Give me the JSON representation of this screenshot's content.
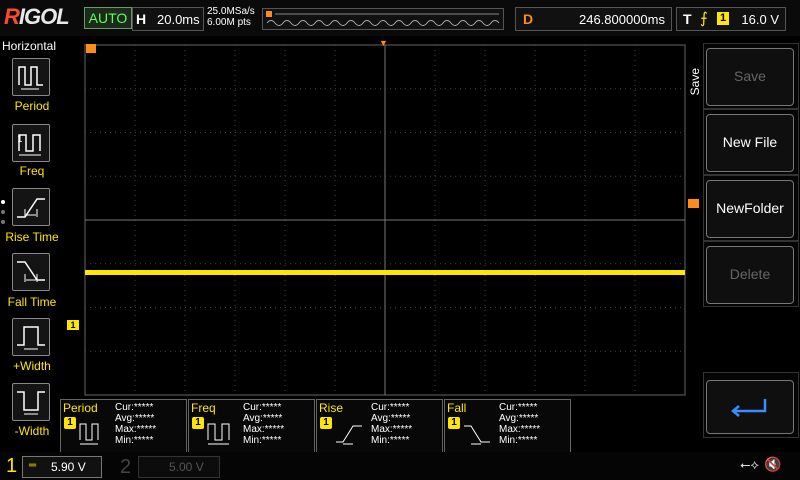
{
  "top": {
    "logo": "RIGOL",
    "run_status": "AUTO",
    "horizontal_label": "H",
    "timebase": "20.0ms",
    "sample_rate": "25.0MSa/s",
    "memory_depth": "6.00M pts",
    "delay_label": "D",
    "delay_value": "246.800000ms",
    "trigger_label": "T",
    "trigger_channel": "1",
    "trigger_level": "16.0 V"
  },
  "left_menu": {
    "header": "Horizontal",
    "items": [
      {
        "label": "Period",
        "icon": "period-icon"
      },
      {
        "label": "Freq",
        "icon": "frequency-icon"
      },
      {
        "label": "Rise Time",
        "icon": "rise-time-icon"
      },
      {
        "label": "Fall Time",
        "icon": "fall-time-icon"
      },
      {
        "label": "+Width",
        "icon": "positive-width-icon"
      },
      {
        "label": "-Width",
        "icon": "negative-width-icon"
      }
    ]
  },
  "waveform": {
    "channel_marker": "1",
    "trigger_marker": "T",
    "trace_color": "#ffe600",
    "trace_level_fraction_from_top": 0.65
  },
  "measurements": [
    {
      "name": "Period",
      "channel": "1",
      "cur": "Cur:*****",
      "avg": "Avg:*****",
      "max": "Max:*****",
      "min": "Min:*****"
    },
    {
      "name": "Freq",
      "channel": "1",
      "cur": "Cur:*****",
      "avg": "Avg:*****",
      "max": "Max:*****",
      "min": "Min:*****"
    },
    {
      "name": "Rise",
      "channel": "1",
      "cur": "Cur:*****",
      "avg": "Avg:*****",
      "max": "Max:*****",
      "min": "Min:*****"
    },
    {
      "name": "Fall",
      "channel": "1",
      "cur": "Cur:*****",
      "avg": "Avg:*****",
      "max": "Max:*****",
      "min": "Min:*****"
    }
  ],
  "right_menu": {
    "title": "Save",
    "buttons": [
      {
        "label": "Save",
        "enabled": false
      },
      {
        "label": "New File",
        "enabled": true
      },
      {
        "label": "NewFolder",
        "enabled": true
      },
      {
        "label": "Delete",
        "enabled": false
      }
    ],
    "return_icon": "return-arrow-icon"
  },
  "bottom": {
    "ch1_number": "1",
    "ch1_scale": "5.90 V",
    "ch2_number": "2",
    "ch2_scale": "5.00 V"
  },
  "colors": {
    "ch1": "#ffe600",
    "accent": "#ff8c1a",
    "auto": "#5cff5c"
  }
}
